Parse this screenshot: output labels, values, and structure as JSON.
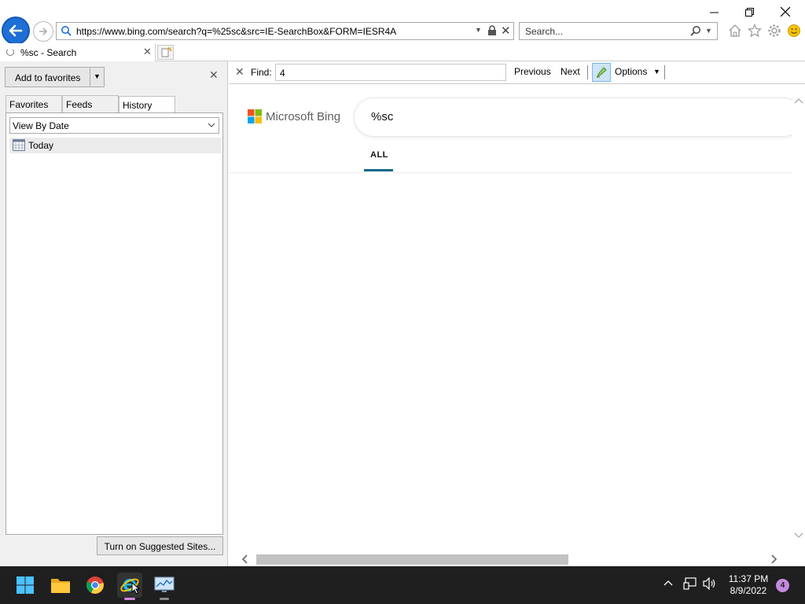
{
  "window": {
    "minimize_glyph": "—",
    "maximize_glyph": "❐",
    "close_glyph": "✕"
  },
  "address_bar": {
    "url": "https://www.bing.com/search?q=%25sc&src=IE-SearchBox&FORM=IESR4A"
  },
  "search_box": {
    "placeholder": "Search..."
  },
  "tab": {
    "title": "%sc - Search"
  },
  "favorites_panel": {
    "add_to_favorites_label": "Add to favorites",
    "tabs": [
      {
        "label": "Favorites"
      },
      {
        "label": "Feeds"
      },
      {
        "label": "History"
      }
    ],
    "active_tab": "History",
    "view_select": "View By Date",
    "history_items": [
      {
        "label": "Today"
      }
    ],
    "suggested_sites_label": "Turn on Suggested Sites..."
  },
  "find_bar": {
    "label": "Find:",
    "value": "4",
    "previous_label": "Previous",
    "next_label": "Next",
    "options_label": "Options"
  },
  "page": {
    "logo_text": "Microsoft Bing",
    "query": "%sc",
    "tabs": [
      {
        "label": "ALL"
      }
    ]
  },
  "taskbar": {
    "time": "11:37 PM",
    "date": "8/9/2022",
    "notification_count": "4"
  },
  "colors": {
    "accent_blue": "#1e6fd6",
    "taskbar_bg": "#1f1f1f",
    "active_indicator": "#d089e0"
  }
}
